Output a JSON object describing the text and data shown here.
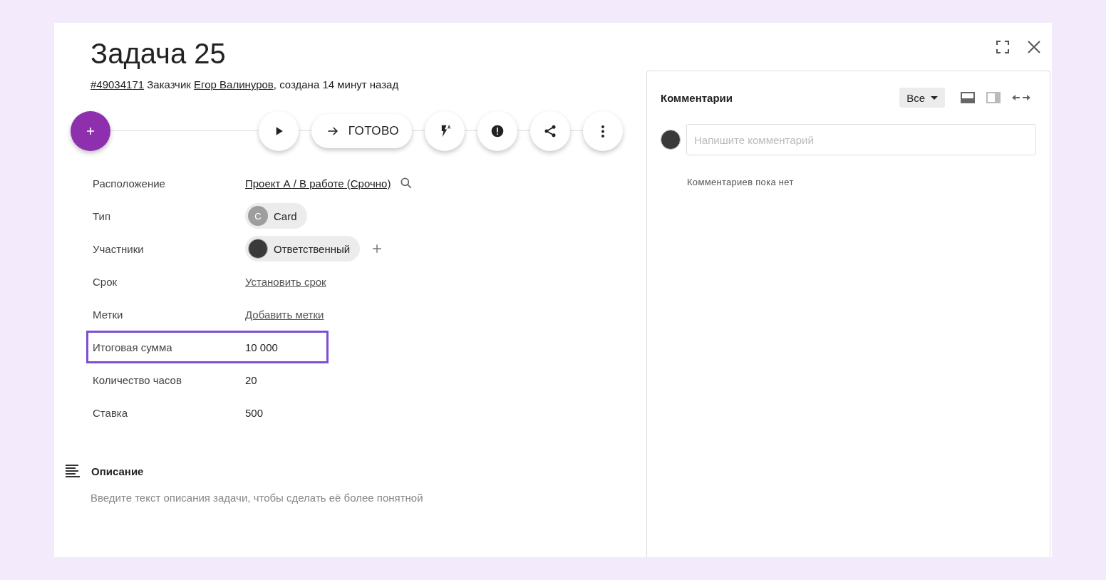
{
  "task": {
    "title": "Задача 25",
    "meta": [
      {
        "text": "#49034171",
        "link": true
      },
      {
        "text": " Заказчик ",
        "link": false
      },
      {
        "text": "Егор Валинуров",
        "link": true
      },
      {
        "text": ", создана 14 минут назад",
        "link": false
      }
    ]
  },
  "toolbar": {
    "status_button": "ГОТОВО"
  },
  "fields": [
    {
      "label": "Расположение",
      "kind": "link",
      "value": "Проект А / В работе (Срочно)",
      "highlighted": false
    },
    {
      "label": "Тип",
      "kind": "chip",
      "value": "Card",
      "chip_letter": "C",
      "highlighted": false
    },
    {
      "label": "Участники",
      "kind": "person",
      "value": "Ответственный",
      "highlighted": false
    },
    {
      "label": "Срок",
      "kind": "action",
      "value": "Установить срок",
      "highlighted": false
    },
    {
      "label": "Метки",
      "kind": "action",
      "value": "Добавить метки",
      "highlighted": false
    },
    {
      "label": "Итоговая сумма",
      "kind": "text",
      "value": "10 000",
      "highlighted": true
    },
    {
      "label": "Количество часов",
      "kind": "text",
      "value": "20",
      "highlighted": false
    },
    {
      "label": "Ставка",
      "kind": "text",
      "value": "500",
      "highlighted": false
    }
  ],
  "description": {
    "title": "Описание",
    "placeholder": "Введите текст описания задачи, чтобы сделать её более понятной"
  },
  "comments": {
    "title": "Комментарии",
    "filter": "Все",
    "placeholder": "Напишите комментарий",
    "empty": "Комментариев пока нет"
  }
}
